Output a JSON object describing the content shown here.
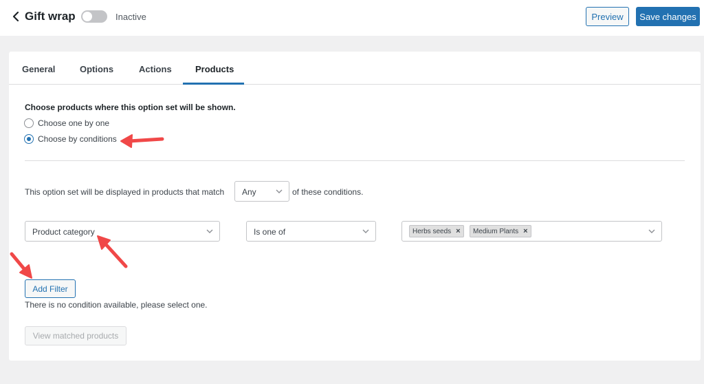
{
  "header": {
    "title": "Gift wrap",
    "status_label": "Inactive",
    "preview_label": "Preview",
    "save_label": "Save changes"
  },
  "tabs": [
    {
      "label": "General"
    },
    {
      "label": "Options"
    },
    {
      "label": "Actions"
    },
    {
      "label": "Products",
      "active": true
    }
  ],
  "products": {
    "heading": "Choose products where this option set will be shown.",
    "radio_options": [
      {
        "label": "Choose one by one",
        "checked": false
      },
      {
        "label": "Choose by conditions",
        "checked": true
      }
    ],
    "match_prefix": "This option set will be displayed in products that match",
    "match_value": "Any",
    "match_suffix": "of these conditions.",
    "condition": {
      "field": "Product category",
      "operator": "Is one of",
      "values": [
        "Herbs seeds",
        "Medium Plants"
      ]
    },
    "add_filter_label": "Add Filter",
    "no_condition_text": "There is no condition available, please select one.",
    "view_matched_label": "View matched products"
  },
  "colors": {
    "accent": "#2271b1",
    "annotation_arrow": "#f04848"
  }
}
